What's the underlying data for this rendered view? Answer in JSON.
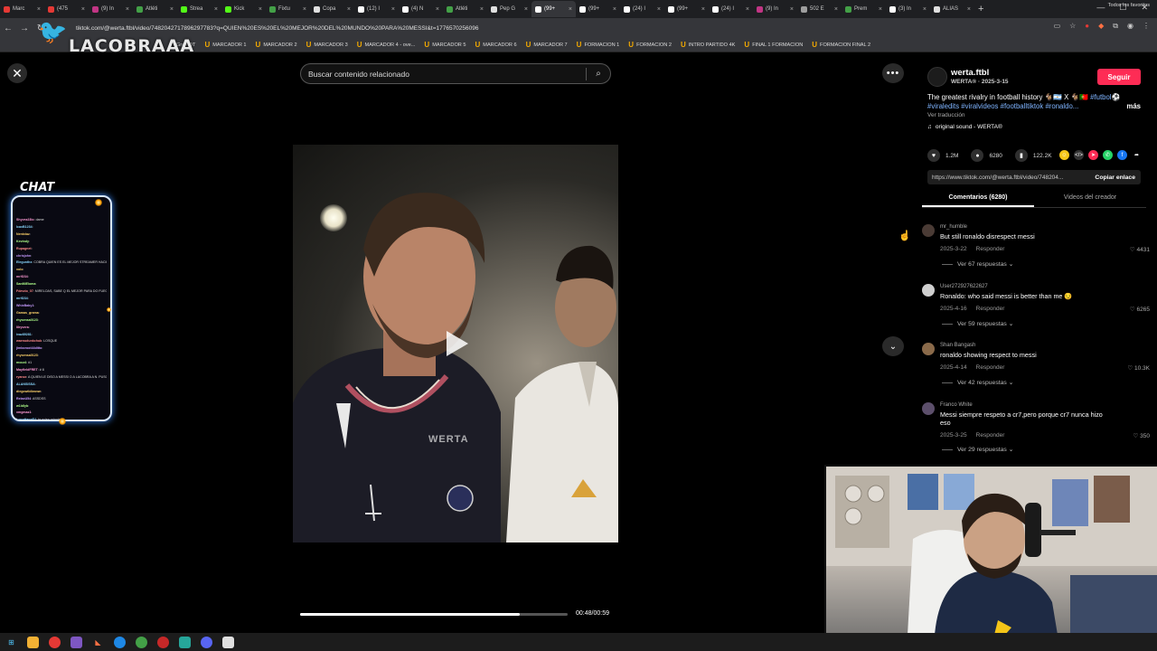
{
  "browser": {
    "tabs": [
      {
        "label": "Marc",
        "color": "#e53935"
      },
      {
        "label": "(475",
        "color": "#e53935"
      },
      {
        "label": "(9) In",
        "color": "#c13584"
      },
      {
        "label": "Atléti",
        "color": "#43a047"
      },
      {
        "label": "Strea",
        "color": "#53fc18"
      },
      {
        "label": "Kick",
        "color": "#53fc18"
      },
      {
        "label": "Fixtu",
        "color": "#43a047"
      },
      {
        "label": "Copa",
        "color": "#e0e0e0"
      },
      {
        "label": "(12) I",
        "color": "#ffffff"
      },
      {
        "label": "(4) N",
        "color": "#ffffff"
      },
      {
        "label": "Atléti",
        "color": "#43a047"
      },
      {
        "label": "Pep G",
        "color": "#e0e0e0"
      },
      {
        "label": "(99+",
        "color": "#ffffff",
        "active": true
      },
      {
        "label": "(99+",
        "color": "#ffffff"
      },
      {
        "label": "(24) I",
        "color": "#ffffff"
      },
      {
        "label": "(99+",
        "color": "#ffffff"
      },
      {
        "label": "(24) I",
        "color": "#ffffff"
      },
      {
        "label": "(9) In",
        "color": "#c13584"
      },
      {
        "label": "502 E",
        "color": "#9e9e9e"
      },
      {
        "label": "Prem",
        "color": "#43a047"
      },
      {
        "label": "(3) In",
        "color": "#ffffff"
      },
      {
        "label": "ALIAS",
        "color": "#e0e0e0"
      }
    ],
    "url": "tiktok.com/@werta.ftbl/video/7482042717896297783?q=QUIEN%20ES%20EL%20MEJOR%20DEL%20MUNDO%20PARA%20MESSI&t=1776570256096",
    "bookmarks": [
      "MARCADOR 1",
      "MARCADOR 2",
      "MARCADOR 3",
      "MARCADOR 4 - ove...",
      "MARCADOR 5",
      "MARCADOR 6",
      "MARCADOR 7",
      "FORMACION 1",
      "FORMACION 2",
      "INTRO PARTIDO 4K",
      "FINAL 1 FORMACION",
      "FORMACION FINAL 2"
    ],
    "bookmark_prefix": "Gran DT",
    "bookmarks_right": "Todos los favoritos"
  },
  "stream": {
    "logo_text": "LACOBRAAA",
    "chat_title": "CHAT",
    "chat_lines": [
      {
        "user": "Shyvez23lo",
        "color": "#ff9ad5",
        "text": ": dame"
      },
      {
        "user": "lcaxB1234",
        "color": "#8ad8ff",
        "text": ":"
      },
      {
        "user": "Nentxiaz",
        "color": "#ffd36b",
        "text": ":"
      },
      {
        "user": "Kevindy",
        "color": "#b0ff8a",
        "text": ":"
      },
      {
        "user": "Rupagnet",
        "color": "#ff8a8a",
        "text": ":"
      },
      {
        "user": "chrisjohn",
        "color": "#c69bff",
        "text": ":"
      },
      {
        "user": "Elegunthx",
        "color": "#8ad8ff",
        "text": ": COBRA QUIEN ES EL MEJOR STREAMER HACIENDO EL DO"
      },
      {
        "user": "xolo",
        "color": "#ffd36b",
        "text": ":"
      },
      {
        "user": "mrlf234",
        "color": "#ff9ad5",
        "text": ":"
      },
      {
        "user": "SanMiEloma",
        "color": "#b0ff8a",
        "text": ":"
      },
      {
        "user": "Fdevdo_07",
        "color": "#ff8a8a",
        "text": ": MIRELOAS, SABE Q EL MEJOR PARA DO FUEGO ESCABLE"
      },
      {
        "user": "mrlf234",
        "color": "#8ad8ff",
        "text": ":"
      },
      {
        "user": "WhixBaby1",
        "color": "#c69bff",
        "text": ":"
      },
      {
        "user": "Gamas_grama",
        "color": "#ffd36b",
        "text": ":"
      },
      {
        "user": "rhysensa0123",
        "color": "#b0ff8a",
        "text": ":"
      },
      {
        "user": "lilryvera",
        "color": "#ff9ad5",
        "text": ":"
      },
      {
        "user": "ivaz89281",
        "color": "#8ad8ff",
        "text": ":"
      },
      {
        "user": "waenudunkchuk",
        "color": "#ff8a8a",
        "text": ": LOSQUE"
      },
      {
        "user": "jimboroot44ditto",
        "color": "#c69bff",
        "text": ":"
      },
      {
        "user": "rhysensa0123",
        "color": "#ffd36b",
        "text": ":"
      },
      {
        "user": "mocz4",
        "color": "#b0ff8a",
        "text": ": #1"
      },
      {
        "user": "MayfieldFRET",
        "color": "#ff9ad5",
        "text": ": # 8"
      },
      {
        "user": "ryanzz",
        "color": "#ff8a8a",
        "text": ": A QUIEN LE DISO A MESSI O A LACOBRA A N. PUSO"
      },
      {
        "user": "ALANSISSA",
        "color": "#8ad8ff",
        "text": ":"
      },
      {
        "user": "diegowildbrown",
        "color": "#ffd36b",
        "text": ":"
      },
      {
        "user": "RelaxU54",
        "color": "#c69bff",
        "text": ": ASSDSS"
      },
      {
        "user": "w1ldlyb",
        "color": "#b0ff8a",
        "text": ":"
      },
      {
        "user": "xmgmaz1",
        "color": "#ff9ad5",
        "text": ":"
      },
      {
        "user": "LongHaneE4",
        "color": "#8ad8ff",
        "text": ": ta quien aringiar"
      },
      {
        "user": "CamoenpunN",
        "color": "#ffd36b",
        "text": ": APRENDE TAVAN"
      }
    ]
  },
  "viewer": {
    "search_placeholder": "Buscar contenido relacionado",
    "video_watermark": "WERTA",
    "progress": 0.82,
    "time": "00:48/00:59"
  },
  "post": {
    "author": "werta.ftbl",
    "author_sub": "WERTA® · 2025-3-15",
    "follow_label": "Seguir",
    "desc_text": "The greatest rivalry in football history 🐐🇦🇷 X 🐐🇵🇹",
    "desc_tags": "#futbol⚽",
    "desc_tags2": "#viraledits #viralvideos #footballtiktok #ronaldo...",
    "more_label": "más",
    "translate_label": "Ver traducción",
    "sound_label": "original sound - WERTA®",
    "likes": "1.2M",
    "comments": "6280",
    "saves": "122.2K",
    "link": "https://www.tiktok.com/@werta.ftbl/video/748204...",
    "copy_label": "Copiar enlace",
    "tab_comments": "Comentarios (6280)",
    "tab_creator": "Videos del creador",
    "colors": {
      "accent": "#fe2c55",
      "hashtag": "#7fb4ff"
    }
  },
  "comments": [
    {
      "user": "mr_humble",
      "text": "But still ronaldo disrespect messi",
      "date": "2025-3-22",
      "reply": "Responder",
      "likes": "4431",
      "replies": "Ver 67 respuestas ⌄",
      "avatar": "#4a3b35"
    },
    {
      "user": "User272927622627",
      "text": "Ronaldo: who said messi is better than me 😏",
      "date": "2025-4-16",
      "reply": "Responder",
      "likes": "6265",
      "replies": "Ver 59 respuestas ⌄",
      "avatar": "#cfcfcf"
    },
    {
      "user": "Shan Bangash",
      "text": "ronaldo showing respect to messi",
      "date": "2025-4-14",
      "reply": "Responder",
      "likes": "10.3K",
      "replies": "Ver 42 respuestas ⌄",
      "avatar": "#8a6a4a"
    },
    {
      "user": "Franco White",
      "text": "Messi siempre respeto a cr7,pero porque cr7 nunca hizo eso",
      "date": "2025-3-25",
      "reply": "Responder",
      "likes": "350",
      "replies": "Ver 29 respuestas ⌄",
      "avatar": "#5c4f6b"
    }
  ]
}
